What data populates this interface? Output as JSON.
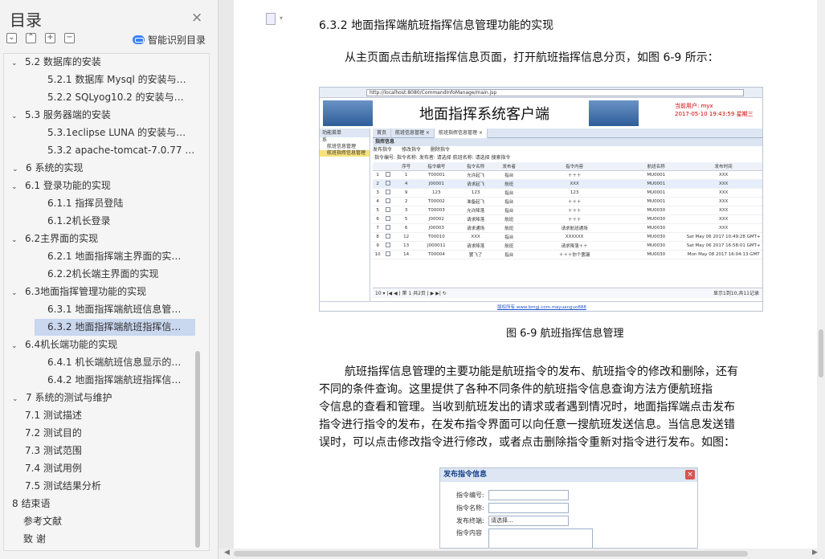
{
  "sidebar": {
    "title": "目录",
    "close": "×",
    "toolbar": [
      "⌄",
      "⌃",
      "+",
      "−"
    ],
    "ai_label": "智能识别目录",
    "items": [
      {
        "label": "5.2 数据库的安装",
        "caret": "⌄",
        "indent": 1
      },
      {
        "label": "5.2.1 数据库 Mysql 的安装与…",
        "caret": "",
        "indent": 2
      },
      {
        "label": "5.2.2 SQLyog10.2 的安装与…",
        "caret": "",
        "indent": 2
      },
      {
        "label": "5.3 服务器端的安装",
        "caret": "⌄",
        "indent": 1
      },
      {
        "label": "5.3.1eclipse LUNA 的安装与…",
        "caret": "",
        "indent": 2
      },
      {
        "label": "5.3.2 apache-tomcat-7.0.77 …",
        "caret": "",
        "indent": 2
      },
      {
        "label": "6 系统的实现",
        "caret": "⌄",
        "indent": 0
      },
      {
        "label": "6.1 登录功能的实现",
        "caret": "⌄",
        "indent": 1
      },
      {
        "label": "6.1.1 指挥员登陆",
        "caret": "",
        "indent": 2
      },
      {
        "label": "6.1.2机长登录",
        "caret": "",
        "indent": 2
      },
      {
        "label": "6.2主界面的实现",
        "caret": "⌄",
        "indent": 1
      },
      {
        "label": "6.2.1 地面指挥端主界面的实…",
        "caret": "",
        "indent": 2
      },
      {
        "label": "6.2.2机长端主界面的实现",
        "caret": "",
        "indent": 2
      },
      {
        "label": "6.3地面指挥管理功能的实现",
        "caret": "⌄",
        "indent": 1
      },
      {
        "label": "6.3.1 地面指挥端航班信息管…",
        "caret": "",
        "indent": 2
      },
      {
        "label": "6.3.2 地面指挥端航班指挥信…",
        "caret": "",
        "indent": 2,
        "selected": true
      },
      {
        "label": "6.4机长端功能的实现",
        "caret": "⌄",
        "indent": 1
      },
      {
        "label": "6.4.1 机长端航班信息显示的…",
        "caret": "",
        "indent": 2
      },
      {
        "label": "6.4.2 地面指挥端航班指挥信…",
        "caret": "",
        "indent": 2
      },
      {
        "label": "7 系统的测试与维护",
        "caret": "⌄",
        "indent": 0
      },
      {
        "label": "7.1 测试描述",
        "caret": "",
        "indent": 1
      },
      {
        "label": "7.2 测试目的",
        "caret": "",
        "indent": 1
      },
      {
        "label": "7.3 测试范围",
        "caret": "",
        "indent": 1
      },
      {
        "label": "7.4 测试用例",
        "caret": "",
        "indent": 1
      },
      {
        "label": "7.5 测试结果分析",
        "caret": "",
        "indent": 1
      },
      {
        "label": "8 结束语",
        "caret": "",
        "indent": 0
      },
      {
        "label": "参考文献",
        "caret": "",
        "indent": -1
      },
      {
        "label": "致 谢",
        "caret": "",
        "indent": -1
      }
    ]
  },
  "doc": {
    "heading": "6.3.2 地面指挥端航班指挥信息管理功能的实现",
    "para1": "从主页面点击航班指挥信息页面，打开航班指挥信息分页，如图 6-9 所示：",
    "caption": "图 6-9 航班指挥信息管理",
    "para2_lines": [
      "航班指挥信息管理的主要功能是航班指令的发布、航班指令的修改和删除，还有",
      "不同的条件查询。这里提供了各种不同条件的航班指令信息查询方法方便航班指",
      "令信息的查看和管理。当收到航班发出的请求或者遇到情况时，地面指挥端点击发布",
      "指令进行指令的发布，在发布指令界面可以向任意一搜航班发送信息。当信息发送错",
      "误时，可以点击修改指令进行修改，或者点击删除指令重新对指令进行发布。如图："
    ]
  },
  "shot1": {
    "url": "http://localhost:8080/CommandInfoManage/main.jsp",
    "title": "地面指挥系统客户端",
    "user_label": "当前用户: myx",
    "datetime": "2017-05-10 19:43:59 星期三",
    "left_header": "功能菜单",
    "left_items": [
      "航班信息管理",
      "航班指挥信息管理"
    ],
    "left_root": "系",
    "tabs": [
      "首页",
      "航班信息管理 ×",
      "航班指挥信息管理 ×"
    ],
    "panel_title": "指挥信息",
    "tools": [
      "发布指令",
      "修改指令",
      "删除指令"
    ],
    "filters": "指令编号:          指令名称:          发布者: 请选择          航班名称: 请选择          搜索指令",
    "columns": [
      "",
      "",
      "序号",
      "指令编号",
      "指令名称",
      "发布者",
      "指令内容",
      "航班名称",
      "发布时间"
    ],
    "rows": [
      [
        "1",
        "",
        "1",
        "T00001",
        "允许起飞",
        "指台",
        "＋＋＋",
        "MU0001",
        "XXX"
      ],
      [
        "2",
        "",
        "4",
        "J00001",
        "请求起飞",
        "航班",
        "XXX",
        "MU0001",
        "XXX"
      ],
      [
        "3",
        "",
        "9",
        "123",
        "123",
        "指台",
        "123",
        "MU0001",
        "XXX"
      ],
      [
        "4",
        "",
        "2",
        "T00002",
        "准备起飞",
        "指台",
        "＋＋＋",
        "MU0001",
        "XXX"
      ],
      [
        "5",
        "",
        "3",
        "T00003",
        "允许降落",
        "指台",
        "＋＋＋",
        "MU0030",
        "XXX"
      ],
      [
        "6",
        "",
        "5",
        "J00002",
        "请求降落",
        "航班",
        "＋＋＋",
        "MU0030",
        "XXX"
      ],
      [
        "7",
        "",
        "6",
        "J00003",
        "请求通场",
        "航班",
        "请求航班通场",
        "MU0030",
        "XXX"
      ],
      [
        "8",
        "",
        "12",
        "T00010",
        "XXX",
        "指台",
        "XXXXXX",
        "MU0030",
        "Sat May 06 2017 10:49:28 GMT+"
      ],
      [
        "9",
        "",
        "13",
        "J000011",
        "请求降落",
        "航班",
        "请求降落＋＋",
        "MU0030",
        "Sat May 06 2017 16:58:01 GMT+"
      ],
      [
        "10",
        "",
        "14",
        "T00004",
        "罢飞了",
        "指台",
        "＋＋＋你个罢漏",
        "MU0030",
        "Mon May 08 2017 16:04:13 GMT"
      ]
    ],
    "pager": "10 ▾  |◀ ◀ | 第 1 共2页 | ▶ ▶| ↻",
    "pager_right": "显示1到10,共11记录",
    "footer": "版权所有 www.bmgj.com.mayuanguo888"
  },
  "shot2": {
    "title": "发布指令信息",
    "close": "×",
    "labels": [
      "指令编号:",
      "指令名称:",
      "发布终端:",
      "指令内容"
    ],
    "select_value": "请选择..."
  }
}
